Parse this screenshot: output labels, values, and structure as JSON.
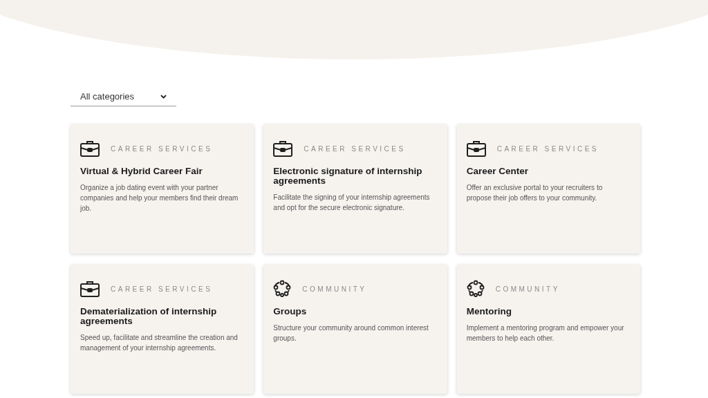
{
  "filter": {
    "value": "All categories"
  },
  "cards": [
    {
      "kind": "briefcase",
      "category": "CAREER SERVICES",
      "title": "Virtual & Hybrid Career Fair",
      "description": "Organize a job dating event with your partner companies and help your members find their dream job."
    },
    {
      "kind": "briefcase",
      "category": "CAREER SERVICES",
      "title": "Electronic signature of internship agreements",
      "description": "Facilitate the signing of your internship agreements and opt for the secure electronic signature."
    },
    {
      "kind": "briefcase",
      "category": "CAREER SERVICES",
      "title": "Career Center",
      "description": "Offer an exclusive portal to your recruiters to propose their job offers to your community."
    },
    {
      "kind": "briefcase",
      "category": "CAREER SERVICES",
      "title": "Dematerialization of internship agreements",
      "description": "Speed up, facilitate and streamline the creation and management of your internship agreements."
    },
    {
      "kind": "community",
      "category": "COMMUNITY",
      "title": "Groups",
      "description": "Structure your community around common interest groups."
    },
    {
      "kind": "community",
      "category": "COMMUNITY",
      "title": "Mentoring",
      "description": "Implement a mentoring program and empower your members to help each other."
    }
  ]
}
